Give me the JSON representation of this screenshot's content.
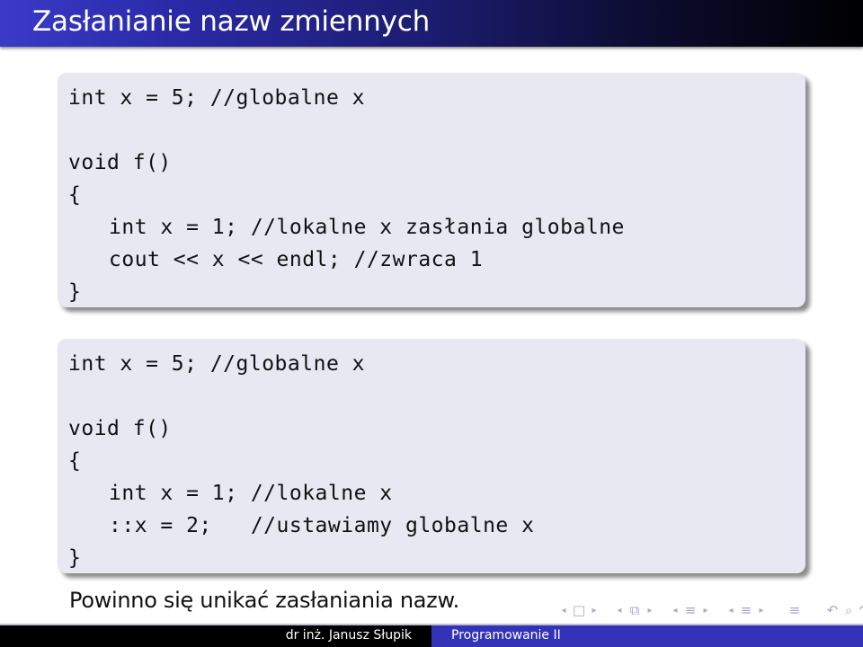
{
  "slide": {
    "title": "Zasłanianie nazw zmiennych"
  },
  "code_blocks": [
    {
      "lines": [
        "int x = 5; //globalne x",
        "",
        "void f()",
        "{",
        "int x = 1; //lokalne x zasłania globalne",
        "cout << x << endl; //zwraca 1",
        "}"
      ]
    },
    {
      "lines": [
        "int x = 5; //globalne x",
        "",
        "void f()",
        "{",
        "int x = 1; //lokalne x",
        "::x = 2;   //ustawiamy globalne x",
        "}"
      ]
    }
  ],
  "note": "Powinno się unikać zasłaniania nazw.",
  "navigation": {
    "icons": [
      {
        "name": "frame-prev",
        "glyph": "◂"
      },
      {
        "name": "frame",
        "glyph": "□"
      },
      {
        "name": "frame-next",
        "glyph": "▸"
      },
      {
        "name": "slide-prev",
        "glyph": "◂"
      },
      {
        "name": "slide",
        "glyph": "⧉"
      },
      {
        "name": "slide-next",
        "glyph": "▸"
      },
      {
        "name": "subsection-prev",
        "glyph": "◂"
      },
      {
        "name": "subsection",
        "glyph": "≡"
      },
      {
        "name": "subsection-next",
        "glyph": "▸"
      },
      {
        "name": "section-prev",
        "glyph": "◂"
      },
      {
        "name": "section",
        "glyph": "≡"
      },
      {
        "name": "section-next",
        "glyph": "▸"
      },
      {
        "name": "toc",
        "glyph": "≡"
      },
      {
        "name": "back",
        "glyph": "↶"
      },
      {
        "name": "search",
        "glyph": "⌕"
      },
      {
        "name": "forward",
        "glyph": "↷"
      }
    ]
  },
  "footer": {
    "author": "dr inż. Janusz Słupik",
    "course": "Programowanie II"
  },
  "colors": {
    "title_gradient_start": "#3a3ac8",
    "title_gradient_end": "#000000",
    "code_background": "#e8e8f2",
    "footer_left": "#000000",
    "footer_right": "#3333b8",
    "nav_icons": "#a8a8cc"
  }
}
